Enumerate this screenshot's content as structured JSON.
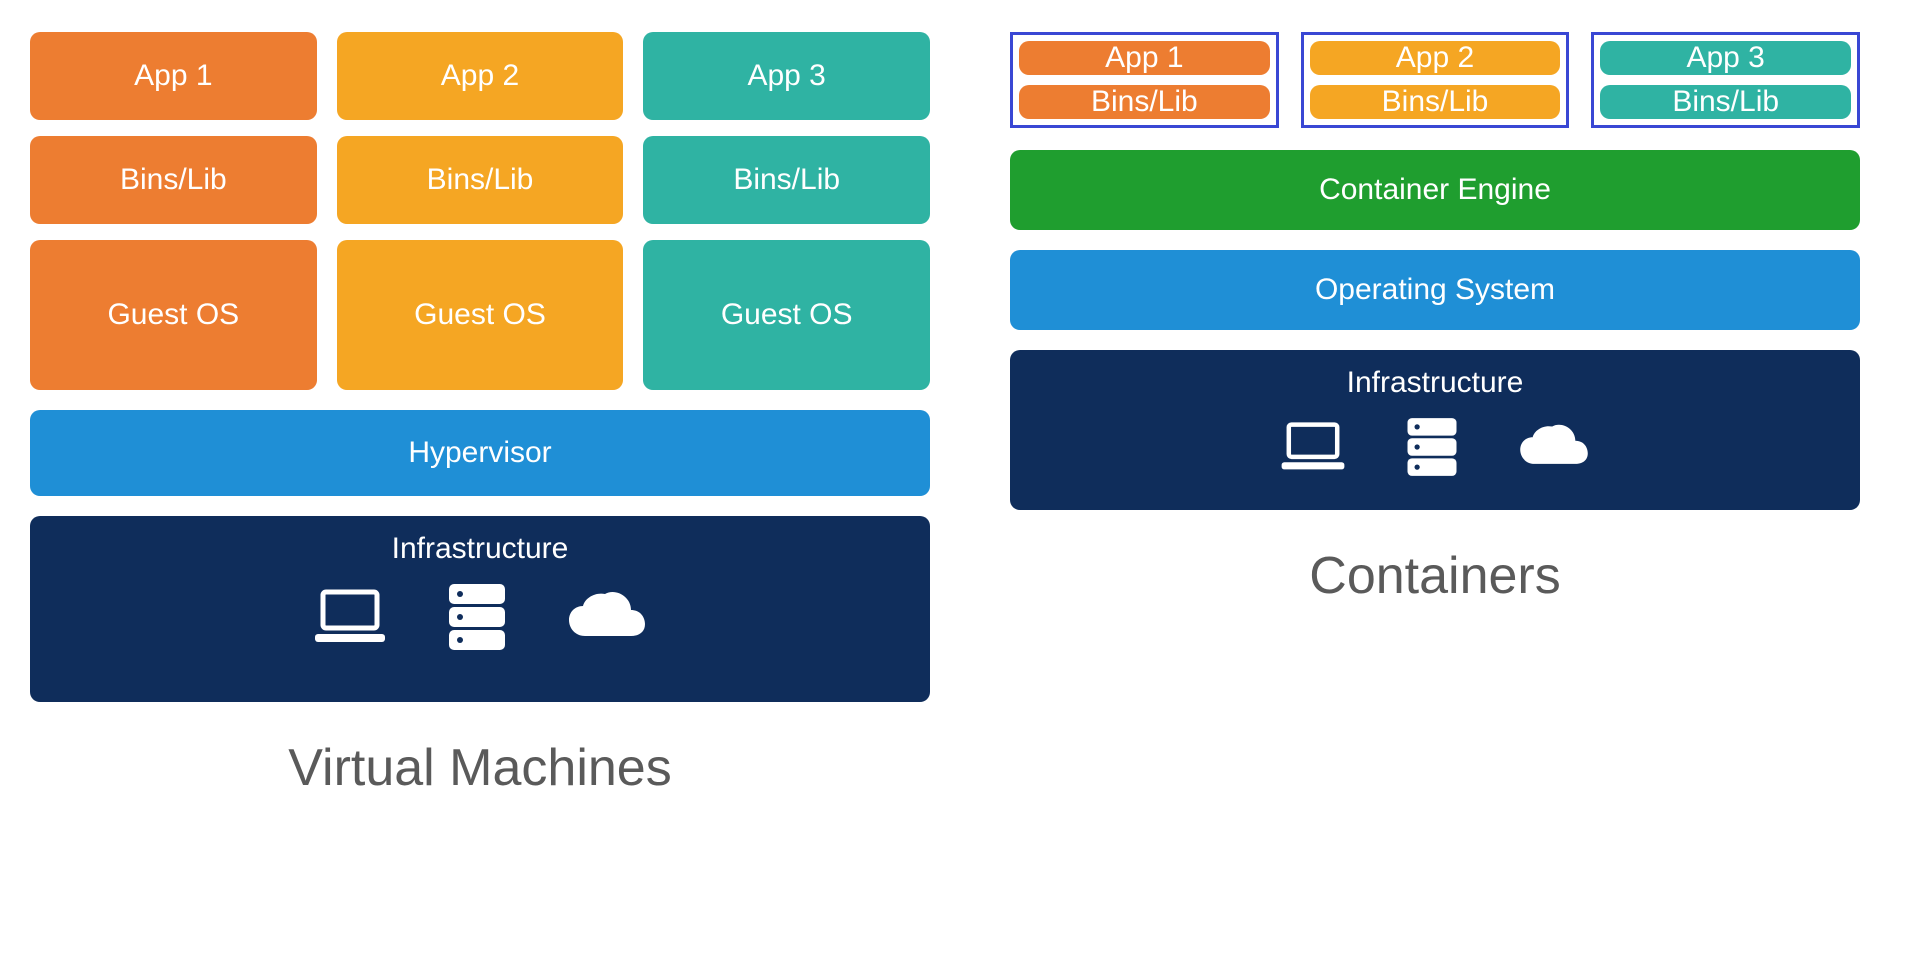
{
  "vm": {
    "apps": [
      "App 1",
      "App 2",
      "App 3"
    ],
    "bins": [
      "Bins/Lib",
      "Bins/Lib",
      "Bins/Lib"
    ],
    "guest": [
      "Guest OS",
      "Guest OS",
      "Guest OS"
    ],
    "hypervisor": "Hypervisor",
    "infrastructure": "Infrastructure",
    "title": "Virtual Machines"
  },
  "containers": {
    "apps": [
      "App 1",
      "App 2",
      "App 3"
    ],
    "bins": [
      "Bins/Lib",
      "Bins/Lib",
      "Bins/Lib"
    ],
    "engine": "Container Engine",
    "os": "Operating System",
    "infrastructure": "Infrastructure",
    "title": "Containers"
  },
  "colors": {
    "orange": "#ed7d31",
    "amber": "#f5a623",
    "teal": "#2fb3a3",
    "blue": "#1f8fd6",
    "green": "#1f9e2f",
    "navy": "#0f2d5b",
    "outline": "#3947d4"
  }
}
